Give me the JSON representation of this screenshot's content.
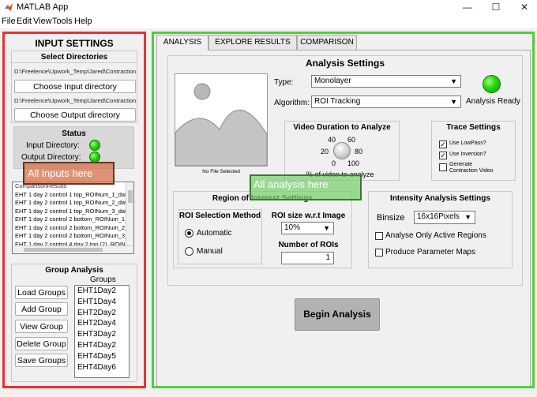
{
  "window": {
    "title": "MATLAB App",
    "min": "—",
    "max": "☐",
    "close": "✕"
  },
  "menu": [
    "File",
    "Edit",
    "View",
    "Tools",
    "Help"
  ],
  "left": {
    "title": "INPUT SETTINGS",
    "select_dirs": {
      "title": "Select Directories",
      "input_path": "D:\\Freelence\\Upwork_Temp\\Jared\\Contraction...",
      "input_button": "Choose Input directory",
      "output_path": "D:\\Freelence\\Upwork_Temp\\Jared\\Contraction...",
      "output_button": "Choose Output directory"
    },
    "status": {
      "title": "Status",
      "input_label": "Input Directory:",
      "output_label": "Output Directory:"
    },
    "files": {
      "header": "ComparisonResults",
      "items": [
        "EHT 1 day 2 control 1 top_ROINum_1_data",
        "EHT 1 day 2 control 1 top_ROINum_2_data",
        "EHT 1 day 2 control 1 top_ROINum_3_data",
        "EHT 1 day 2 control 2 bottom_ROINum_1_c",
        "EHT 1 day 2 control 2 bottom_ROINum_2_c",
        "EHT 1 day 2 control 2 bottom_ROINum_3_c",
        "EHT 1 day 2 control 4 day 2 top (2)_ROIN"
      ]
    },
    "group_analysis": {
      "title": "Group Analysis",
      "groups_label": "Groups",
      "buttons": [
        "Load Groups",
        "Add Group",
        "View Group",
        "Delete Group",
        "Save Groups"
      ],
      "groups": [
        "EHT1Day2",
        "EHT1Day4",
        "EHT2Day2",
        "EHT2Day4",
        "EHT3Day2",
        "EHT4Day2",
        "EHT4Day5",
        "EHT4Day6"
      ]
    }
  },
  "tabs": [
    "ANALYSIS",
    "EXPLORE RESULTS",
    "COMPARISON"
  ],
  "analysis": {
    "title": "Analysis Settings",
    "no_file": "No File Selected",
    "type_label": "Type:",
    "type_value": "Monolayer",
    "algorithm_label": "Algorithm:",
    "algorithm_value": "ROI Tracking",
    "ready_label": "Analysis Ready",
    "video": {
      "title": "Video Duration to Analyze",
      "ticks": [
        "40",
        "60",
        "20",
        "80",
        "0",
        "100"
      ],
      "caption": "% of video to analyze"
    },
    "trace": {
      "title": "Trace Settings",
      "opt1": "Use LowPass?",
      "opt2": "Use Inversion?",
      "opt3a": "Generate",
      "opt3b": "Contraction Video",
      "check": "✓"
    },
    "roi": {
      "title": "Region of Interest Settings",
      "method_title": "ROI Selection Method",
      "automatic": "Automatic",
      "manual": "Manual",
      "size_label": "ROI size w.r.t Image",
      "size_value": "10%",
      "num_label": "Number of ROIs",
      "num_value": "1"
    },
    "intensity": {
      "title": "Intensity Analysis Settings",
      "binsize_label": "Binsize",
      "binsize_value": "16x16Pixels",
      "opt1": "Analyse Only Active Regions",
      "opt2": "Produce Parameter Maps"
    },
    "begin_button": "Begin Analysis"
  },
  "annotations": {
    "inputs": "All inputs here",
    "analysis": "All analysis here"
  },
  "colors": {
    "red_box": "#e8322f",
    "green_box": "#4fcf3a",
    "annot_red_bg": "#d97b55",
    "annot_green_bg": "#7fd37a"
  }
}
